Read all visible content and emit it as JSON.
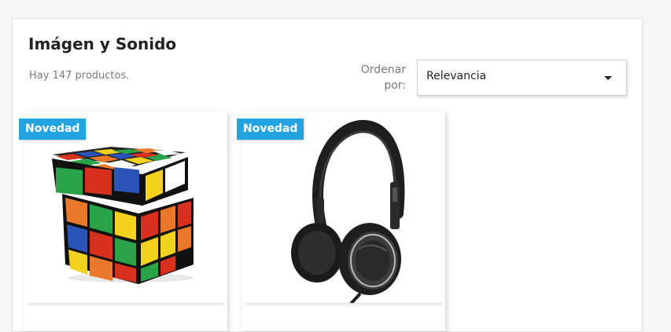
{
  "category": {
    "title": "Imágen y Sonido",
    "product_count_text": "Hay 147 productos."
  },
  "sort": {
    "label": "Ordenar por:",
    "selected": "Relevancia"
  },
  "products": [
    {
      "badge": "Novedad",
      "image": "rubik-cube-speaker"
    },
    {
      "badge": "Novedad",
      "image": "headphones"
    }
  ],
  "colors": {
    "badge_bg": "#23a3e0",
    "title": "#232323",
    "muted": "#7a7a7a"
  }
}
